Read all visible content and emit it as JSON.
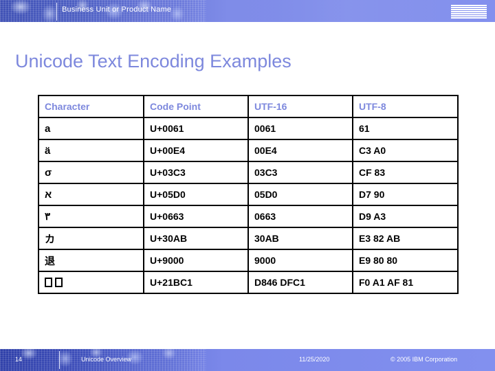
{
  "header": {
    "title": "Business Unit or Product Name",
    "logo": "ibm-logo"
  },
  "title": "Unicode Text Encoding Examples",
  "table": {
    "columns": [
      "Character",
      "Code Point",
      "UTF-16",
      "UTF-8"
    ],
    "rows": [
      {
        "character": "a",
        "code_point": "U+0061",
        "utf16": "0061",
        "utf8": "61"
      },
      {
        "character": "ä",
        "code_point": "U+00E4",
        "utf16": "00E4",
        "utf8": "C3 A0"
      },
      {
        "character": "σ",
        "code_point": "U+03C3",
        "utf16": "03C3",
        "utf8": "CF 83"
      },
      {
        "character": "א",
        "code_point": "U+05D0",
        "utf16": "05D0",
        "utf8": "D7 90"
      },
      {
        "character": "٣",
        "code_point": "U+0663",
        "utf16": "0663",
        "utf8": "D9 A3"
      },
      {
        "character": "カ",
        "code_point": "U+30AB",
        "utf16": "30AB",
        "utf8": "E3 82 AB"
      },
      {
        "character": "退",
        "code_point": "U+9000",
        "utf16": "9000",
        "utf8": "E9 80 80"
      },
      {
        "character": "",
        "code_point": "U+21BC1",
        "utf16": "D846 DFC1",
        "utf8": "F0 A1 AF 81",
        "missing_glyph": true
      }
    ]
  },
  "footer": {
    "page_number": "14",
    "deck_name": "Unicode Overview",
    "date": "11/25/2020",
    "copyright": "© 2005 IBM Corporation"
  },
  "colors": {
    "accent_blue": "#7d88dd",
    "band_blue": "#8290ef",
    "band_dark_blue": "#3f51b5",
    "table_border": "#000000",
    "body_background": "#ffffff"
  }
}
